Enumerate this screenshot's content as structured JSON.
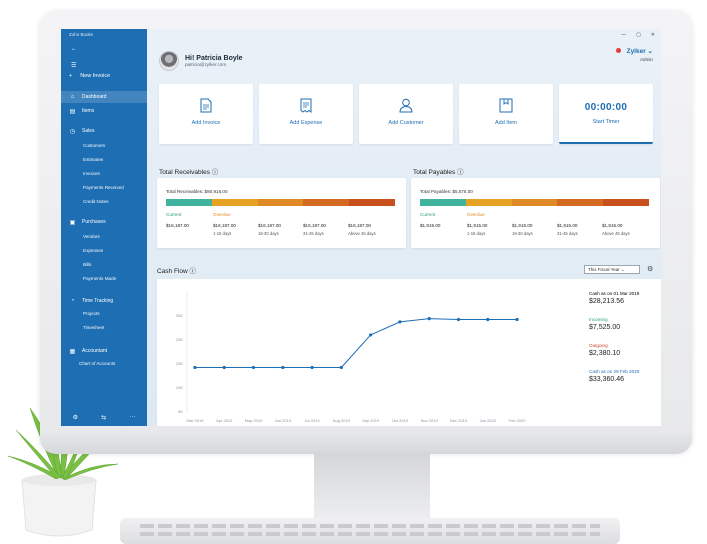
{
  "app": {
    "brand": "Zoho Books"
  },
  "window": {
    "minimize": "—",
    "maximize": "▢",
    "close": "✕"
  },
  "sidebar": {
    "back_icon": "back-arrow-icon",
    "new_invoice": "New Invoice",
    "items": [
      {
        "label": "Dashboard",
        "icon": "home-icon",
        "active": true
      },
      {
        "label": "Items",
        "icon": "items-icon"
      },
      {
        "label": "Sales",
        "icon": "sales-icon"
      },
      {
        "label": "Purchases",
        "icon": "purchases-icon"
      },
      {
        "label": "Time Tracking",
        "icon": "clock-icon"
      },
      {
        "label": "Accountant",
        "icon": "accountant-icon"
      }
    ],
    "sales_sub": [
      "Customers",
      "Estimates",
      "Invoices",
      "Payments Received",
      "Credit Notes"
    ],
    "purchases_sub": [
      "Vendors",
      "Expenses",
      "Bills",
      "Payments Made"
    ],
    "time_sub": [
      "Projects",
      "Timesheet"
    ],
    "accountant_sub": [
      "Chart of Accounts"
    ]
  },
  "user": {
    "greeting": "Hi! Patricia Boyle",
    "email": "patricia@zylker.com"
  },
  "org": {
    "name": "Zylker ⌄",
    "role": "Admin"
  },
  "quick_actions": [
    {
      "label": "Add Invoice",
      "icon": "invoice-icon"
    },
    {
      "label": "Add Expense",
      "icon": "receipt-icon"
    },
    {
      "label": "Add Customer",
      "icon": "person-icon"
    },
    {
      "label": "Add Item",
      "icon": "box-icon"
    }
  ],
  "timer": {
    "value": "00:00:00",
    "label": "Start Timer"
  },
  "receivables": {
    "title": "Total Receivables ⓘ",
    "total": "Total Receivables: $80,916.00",
    "current_label": "Current",
    "overdue_label": "Overdue",
    "cols": [
      {
        "value": "$16,187.00",
        "sub": ""
      },
      {
        "value": "$16,187.00",
        "sub": "1-15 days"
      },
      {
        "value": "$16,187.00",
        "sub": "16-30 days"
      },
      {
        "value": "$16,187.00",
        "sub": "31-45 days"
      },
      {
        "value": "$16,187.00",
        "sub": "Above 45 days"
      }
    ]
  },
  "payables": {
    "title": "Total Payables ⓘ",
    "total": "Total Payables: $5,575.00",
    "current_label": "Current",
    "overdue_label": "Overdue",
    "cols": [
      {
        "value": "$1,915.00",
        "sub": ""
      },
      {
        "value": "$1,915.00",
        "sub": "1-15 days"
      },
      {
        "value": "$1,915.00",
        "sub": "16-30 days"
      },
      {
        "value": "$1,915.00",
        "sub": "31-45 days"
      },
      {
        "value": "$1,915.00",
        "sub": "Above 45 days"
      }
    ]
  },
  "bar_colors": [
    "#3fb39b",
    "#e6a323",
    "#e08a25",
    "#d46a22",
    "#c7501c"
  ],
  "cashflow": {
    "title": "Cash Flow ⓘ",
    "period": "This Fiscal Year ⌄",
    "settings_icon": "settings-icon",
    "summary": [
      {
        "label": "Cash as on  01 Mar 2019",
        "value": "$28,213.56",
        "color": "#333333"
      },
      {
        "label": "Incoming",
        "value": "$7,525.00",
        "color": "#2a9d6f"
      },
      {
        "label": "Outgoing",
        "value": "$2,380.10",
        "color": "#d2452a"
      },
      {
        "label": "Cash as on  29 Feb 2020",
        "value": "$33,360.46",
        "color": "#1e6eb3"
      }
    ]
  },
  "chart_data": {
    "type": "line",
    "categories": [
      "Mar 2019",
      "Apr 2019",
      "May 2019",
      "Jun 2019",
      "Jul 2019",
      "Aug 2019",
      "Sep 2019",
      "Oct 2019",
      "Nov 2019",
      "Dec 2019",
      "Jan 2020",
      "Feb 2020"
    ],
    "y_ticks": [
      "30K",
      "20K",
      "20K",
      "10K",
      "5K"
    ],
    "series": [
      {
        "values": [
          28,
          28,
          28,
          28,
          28,
          28,
          48,
          56,
          58,
          57.5,
          57.5,
          57.5
        ]
      }
    ],
    "ylim": [
      0,
      75
    ],
    "color": "#1e6eb3",
    "grid": false
  }
}
